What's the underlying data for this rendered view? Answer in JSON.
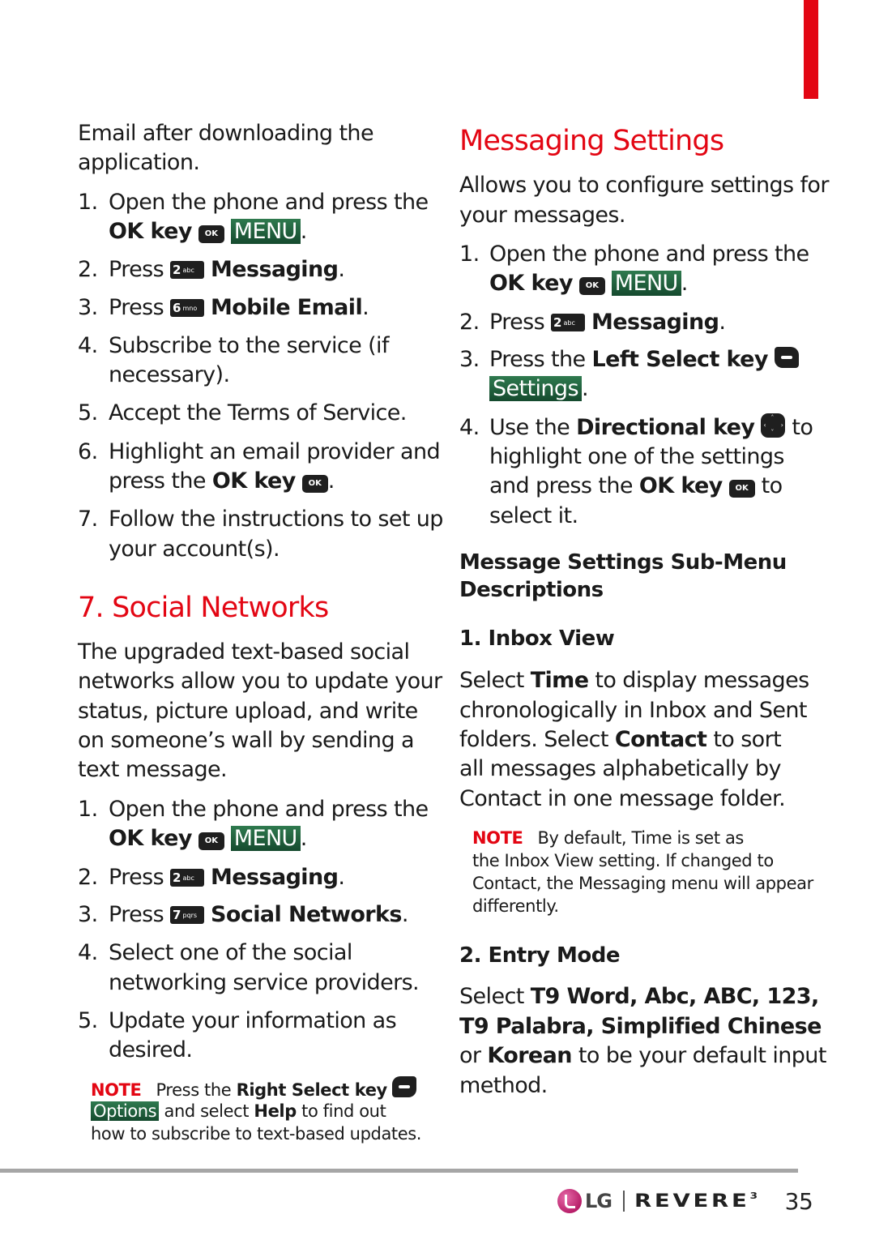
{
  "intro": {
    "line1": "Email after downloading the",
    "line2": "application."
  },
  "email_steps": [
    {
      "num": "1.",
      "line1": "Open the phone and press the",
      "key_label": "OK key",
      "ok_glyph": "OK",
      "softkey": "MENU"
    },
    {
      "num": "2.",
      "pre": "Press",
      "key_digit": "2",
      "key_letters": "abc",
      "label": "Messaging",
      "end": "."
    },
    {
      "num": "3.",
      "pre": "Press",
      "key_digit": "6",
      "key_letters": "mno",
      "label": "Mobile Email",
      "end": "."
    },
    {
      "num": "4.",
      "line1": "Subscribe to the service (if",
      "line2": "necessary)."
    },
    {
      "num": "5.",
      "line1": "Accept the Terms of Service."
    },
    {
      "num": "6.",
      "line1": "Highlight an email provider and",
      "line2_pre": "press the",
      "key_label": "OK key",
      "ok_glyph": "OK",
      "end": "."
    },
    {
      "num": "7.",
      "line1": "Follow the instructions to set up",
      "line2": "your account(s)."
    }
  ],
  "social": {
    "heading": "7. Social Networks",
    "para": [
      "The upgraded text-based social",
      "networks allow you to update your",
      "status, picture upload, and write",
      "on someone’s wall by sending a",
      "text message."
    ],
    "steps": [
      {
        "num": "1.",
        "line1": "Open the phone and press the",
        "key_label": "OK key",
        "ok_glyph": "OK",
        "softkey": "MENU"
      },
      {
        "num": "2.",
        "pre": "Press",
        "key_digit": "2",
        "key_letters": "abc",
        "label": "Messaging",
        "end": "."
      },
      {
        "num": "3.",
        "pre": "Press",
        "key_digit": "7",
        "key_letters": "pqrs",
        "label": "Social Networks",
        "end": "."
      },
      {
        "num": "4.",
        "line1": "Select one of the social",
        "line2": "networking service providers."
      },
      {
        "num": "5.",
        "line1": "Update your information as",
        "line2": "desired."
      }
    ],
    "note": {
      "label": "NOTE",
      "pre": "Press the",
      "key": "Right Select key",
      "softkey": "Options",
      "mid": "and select",
      "help": "Help",
      "post": "to find out",
      "line3": "how to subscribe to text-based updates."
    }
  },
  "messaging_settings": {
    "heading": "Messaging Settings",
    "para": [
      "Allows you to configure settings for",
      "your messages."
    ],
    "steps": [
      {
        "num": "1.",
        "line1": "Open the phone and press the",
        "key_label": "OK key",
        "ok_glyph": "OK",
        "softkey": "MENU"
      },
      {
        "num": "2.",
        "pre": "Press",
        "key_digit": "2",
        "key_letters": "abc",
        "label": "Messaging",
        "end": "."
      },
      {
        "num": "3.",
        "pre": "Press the",
        "key_label": "Left Select key",
        "softkey": "Settings",
        "end": "."
      },
      {
        "num": "4.",
        "pre": "Use the",
        "key_label": "Directional key",
        "post": "to",
        "line2": "highlight one of the settings",
        "line3_pre": "and press the",
        "line3_key": "OK key",
        "ok_glyph": "OK",
        "line3_post": "to",
        "line4": "select it."
      }
    ],
    "submenu_heading": [
      "Message Settings Sub-Menu",
      "Descriptions"
    ],
    "inbox_view": {
      "heading": "1. Inbox View",
      "l1_pre": "Select",
      "l1_bold": "Time",
      "l1_post": "to display messages",
      "l2": "chronologically in Inbox and Sent",
      "l3_pre": "folders. Select",
      "l3_bold": "Contact",
      "l3_post": "to sort",
      "l4": "all messages alphabetically by",
      "l5": "Contact in one message folder.",
      "note": {
        "label": "NOTE",
        "l1": "By default, Time is set as",
        "l2": "the Inbox View setting. If changed to",
        "l3": "Contact, the Messaging menu will appear",
        "l4": "differently."
      }
    },
    "entry_mode": {
      "heading": "2. Entry Mode",
      "l1_pre": "Select",
      "l1_bold": "T9 Word, Abc, ABC, 123,",
      "l2_bold": "T9 Palabra, Simplified Chinese",
      "l3_pre": "or",
      "l3_bold": "Korean",
      "l3_post": "to be your default input",
      "l4": "method."
    }
  },
  "footer": {
    "brand": "LG",
    "model": "REVERE",
    "model_sup": "3",
    "page_number": "35"
  },
  "colors": {
    "accent_red": "#e30613",
    "softkey_green": "#1f5e3a"
  }
}
